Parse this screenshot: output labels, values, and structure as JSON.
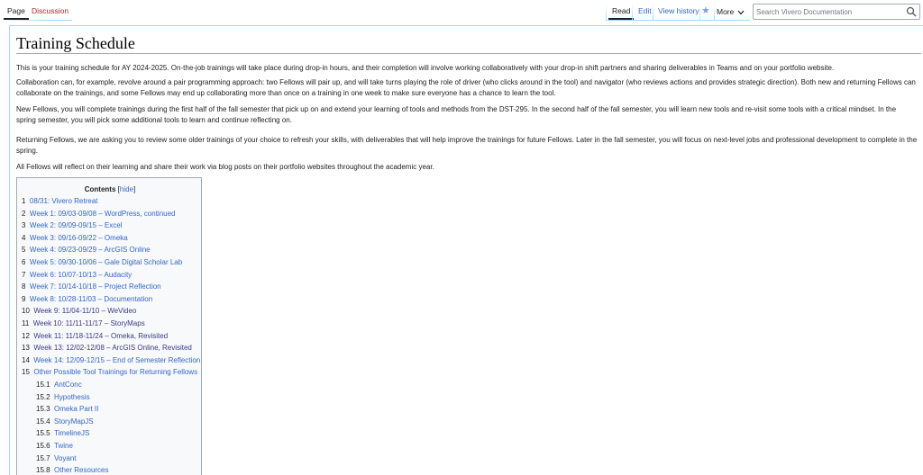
{
  "tabs": {
    "page": "Page",
    "discussion": "Discussion",
    "read": "Read",
    "edit": "Edit",
    "view_history": "View history",
    "more": "More"
  },
  "search": {
    "placeholder": "Search Vivero Documentation"
  },
  "article": {
    "title": "Training Schedule",
    "paragraphs": [
      "This is your training schedule for AY 2024-2025. On-the-job trainings will take place during drop-in hours, and their completion will involve working collaboratively with your drop-in shift partners and sharing deliverables in Teams and on your portfolio website.",
      "Collaboration can, for example, revolve around a pair programming approach: two Fellows will pair up, and will take turns playing the role of driver (who clicks around in the tool) and navigator (who reviews actions and provides strategic direction). Both new and returning Fellows can collaborate on the trainings, and some Fellows may end up collaborating more than once on a training in one week to make sure everyone has a chance to learn the tool.",
      "New Fellows, you will complete trainings during the first half of the fall semester that pick up on and extend your learning of tools and methods from the DST-295. In the second half of the fall semester, you will learn new tools and re-visit some tools with a critical mindset. In the spring semester, you will pick some additional tools to learn and continue reflecting on.",
      "Returning Fellows, we are asking you to review some older trainings of your choice to refresh your skills, with deliverables that will help improve the trainings for future Fellows. Later in the fall semester, you will focus on next-level jobs and professional development to complete in the spring.",
      "All Fellows will reflect on their learning and share their work via blog posts on their portfolio websites throughout the academic year."
    ]
  },
  "toc": {
    "title": "Contents",
    "hide_open": "[",
    "hide_label": "hide",
    "hide_close": "]",
    "items": [
      {
        "num": "1",
        "label": "08/31: Vivero Retreat"
      },
      {
        "num": "2",
        "label": "Week 1: 09/03-09/08 – WordPress, continued"
      },
      {
        "num": "3",
        "label": "Week 2: 09/09-09/15 – Excel"
      },
      {
        "num": "4",
        "label": "Week 3: 09/16-09/22 – Omeka"
      },
      {
        "num": "5",
        "label": "Week 4: 09/23-09/29 – ArcGIS Online"
      },
      {
        "num": "6",
        "label": "Week 5: 09/30-10/06 – Gale Digital Scholar Lab"
      },
      {
        "num": "7",
        "label": "Week 6: 10/07-10/13 – Audacity"
      },
      {
        "num": "8",
        "label": "Week 7: 10/14-10/18 – Project Reflection"
      },
      {
        "num": "9",
        "label": "Week 8: 10/28-11/03 – Documentation"
      },
      {
        "num": "10",
        "label": "Week 9: 11/04-11/10 – WeVideo"
      },
      {
        "num": "11",
        "label": "Week 10: 11/11-11/17 – StoryMaps"
      },
      {
        "num": "12",
        "label": "Week 11: 11/18-11/24 – Omeka, Revisited"
      },
      {
        "num": "13",
        "label": "Week 13: 12/02-12/08 – ArcGIS Online, Revisited"
      },
      {
        "num": "14",
        "label": "Week 14: 12/09-12/15 – End of Semester Reflection"
      },
      {
        "num": "15",
        "label": "Other Possible Tool Trainings for Returning Fellows"
      },
      {
        "num": "15.1",
        "label": "AntConc"
      },
      {
        "num": "15.2",
        "label": "Hypothesis"
      },
      {
        "num": "15.3",
        "label": "Omeka Part II"
      },
      {
        "num": "15.4",
        "label": "StoryMapJS"
      },
      {
        "num": "15.5",
        "label": "TimelineJS"
      },
      {
        "num": "15.6",
        "label": "Twine"
      },
      {
        "num": "15.7",
        "label": "Voyant"
      },
      {
        "num": "15.8",
        "label": "Other Resources"
      }
    ]
  },
  "colors": {
    "link": "#3366cc",
    "visited_link": "#3a3a8a",
    "new_link": "#b32424",
    "tab_border": "#a7d7f9"
  },
  "icons": [
    "star-icon",
    "chevron-down-icon",
    "search-icon"
  ]
}
